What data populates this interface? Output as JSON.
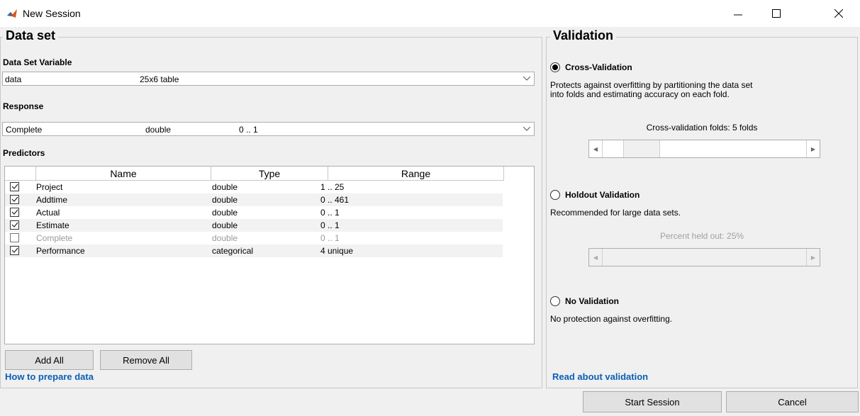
{
  "window": {
    "title": "New Session"
  },
  "dataset": {
    "title": "Data set",
    "variable_label": "Data Set Variable",
    "variable": {
      "name": "data",
      "desc": "25x6 table"
    },
    "response_label": "Response",
    "response": {
      "name": "Complete",
      "type": "double",
      "range": "0 .. 1"
    },
    "predictors_label": "Predictors",
    "columns": [
      "Name",
      "Type",
      "Range"
    ],
    "rows": [
      {
        "checked": true,
        "name": "Project",
        "type": "double",
        "range": "1 .. 25"
      },
      {
        "checked": true,
        "name": "Addtime",
        "type": "double",
        "range": "0 .. 461"
      },
      {
        "checked": true,
        "name": "Actual",
        "type": "double",
        "range": "0 .. 1"
      },
      {
        "checked": true,
        "name": "Estimate",
        "type": "double",
        "range": "0 .. 1"
      },
      {
        "checked": false,
        "name": "Complete",
        "type": "double",
        "range": "0 .. 1"
      },
      {
        "checked": true,
        "name": "Performance",
        "type": "categorical",
        "range": "4 unique"
      }
    ],
    "add_all": "Add All",
    "remove_all": "Remove All",
    "help_link": "How to prepare data"
  },
  "validation": {
    "title": "Validation",
    "cross": {
      "label": "Cross-Validation",
      "desc_line1": "Protects against overfitting by partitioning the data set",
      "desc_line2": "into folds and estimating accuracy on each fold.",
      "folds_label": "Cross-validation folds: 5 folds",
      "folds_value": 5
    },
    "holdout": {
      "label": "Holdout Validation",
      "desc": "Recommended for large data sets.",
      "percent_label": "Percent held out: 25%"
    },
    "none": {
      "label": "No Validation",
      "desc": "No protection against overfitting."
    },
    "selected": "cross",
    "help_link": "Read about validation"
  },
  "footer": {
    "start": "Start Session",
    "cancel": "Cancel"
  },
  "colors": {
    "link": "#0a5fb4",
    "background": "#f0f0f0"
  }
}
